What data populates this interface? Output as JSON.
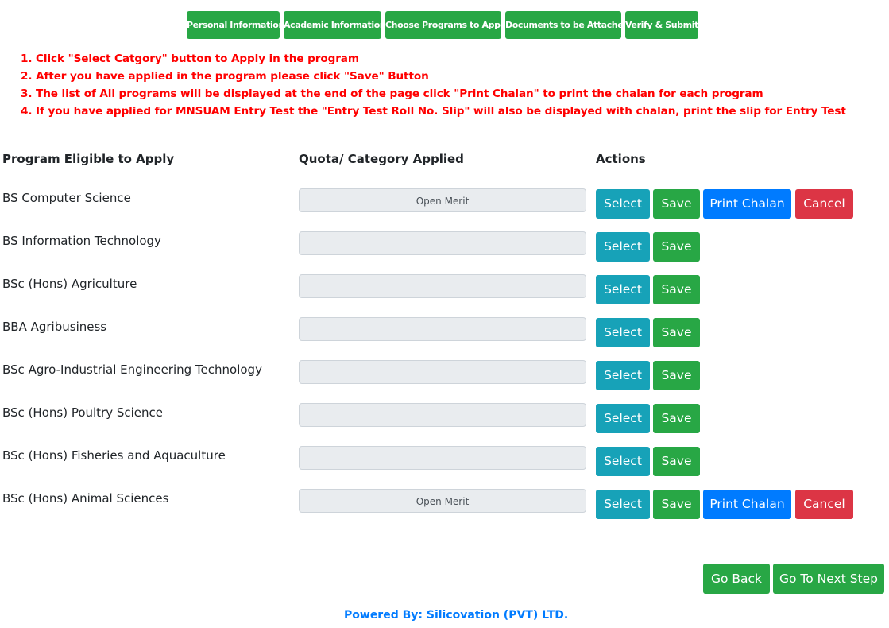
{
  "tabs": [
    {
      "label": "Personal Information"
    },
    {
      "label": "Academic Information"
    },
    {
      "label": "Choose Programs to Apply"
    },
    {
      "label": "Documents to be Attached"
    },
    {
      "label": "Verify & Submit"
    }
  ],
  "instructions": [
    "1. Click \"Select Catgory\" button to Apply in the program",
    "2. After you have applied in the program please click \"Save\" Button",
    "3. The list of All programs will be displayed at the end of the page click \"Print Chalan\" to print the chalan for each program",
    "4. If you have applied for MNSUAM Entry Test the \"Entry Test Roll No. Slip\" will also be displayed with chalan, print the slip for Entry Test"
  ],
  "table": {
    "headers": {
      "program": "Program Eligible to Apply",
      "quota": "Quota/ Category Applied",
      "actions": "Actions"
    },
    "button_labels": {
      "select": "Select",
      "save": "Save",
      "print": "Print Chalan",
      "cancel": "Cancel"
    },
    "rows": [
      {
        "program": "BS Computer Science",
        "quota": "Open Merit"
      },
      {
        "program": "BS Information Technology",
        "quota": ""
      },
      {
        "program": "BSc (Hons) Agriculture",
        "quota": ""
      },
      {
        "program": "BBA Agribusiness",
        "quota": ""
      },
      {
        "program": "BSc Agro-Industrial Engineering Technology",
        "quota": ""
      },
      {
        "program": "BSc (Hons) Poultry Science",
        "quota": ""
      },
      {
        "program": "BSc (Hons) Fisheries and Aquaculture",
        "quota": ""
      },
      {
        "program": "BSc (Hons) Animal Sciences",
        "quota": "Open Merit"
      }
    ]
  },
  "nav": {
    "back": "Go Back",
    "next": "Go To Next Step"
  },
  "footer": "Powered By: Silicovation (PVT) LTD."
}
